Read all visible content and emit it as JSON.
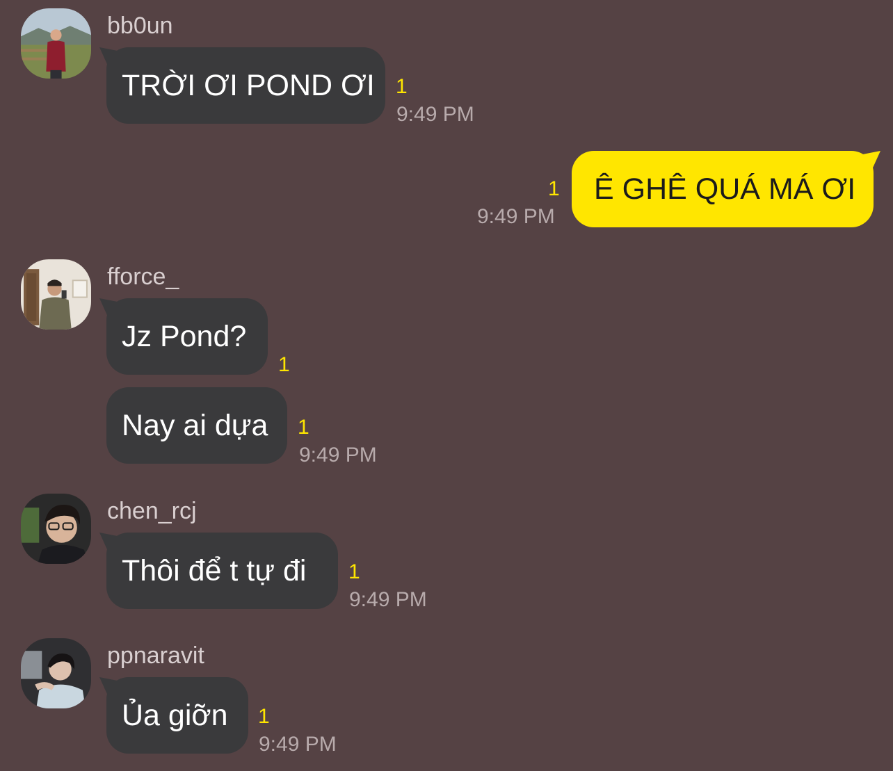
{
  "conversation": {
    "messages": [
      {
        "sender": "bb0un",
        "text": "TRỜI ƠI POND ƠI",
        "unread": "1",
        "time": "9:49 PM"
      },
      {
        "sender": "me",
        "text": "Ê GHÊ QUÁ MÁ ƠI",
        "unread": "1",
        "time": "9:49 PM"
      },
      {
        "sender": "fforce_",
        "text": "Jz Pond?",
        "unread": "1"
      },
      {
        "sender": "fforce_",
        "text": "Nay ai dựa",
        "unread": "1",
        "time": "9:49 PM"
      },
      {
        "sender": "chen_rcj",
        "text": "Thôi để t tự đi",
        "unread": "1",
        "time": "9:49 PM"
      },
      {
        "sender": "ppnaravit",
        "text": "Ủa giỡn",
        "unread": "1",
        "time": "9:49 PM"
      }
    ]
  },
  "colors": {
    "background": "#554244",
    "incoming_bubble": "#3a3a3c",
    "outgoing_bubble": "#ffe600",
    "unread_count": "#ffe600",
    "timestamp": "#b8abac"
  }
}
